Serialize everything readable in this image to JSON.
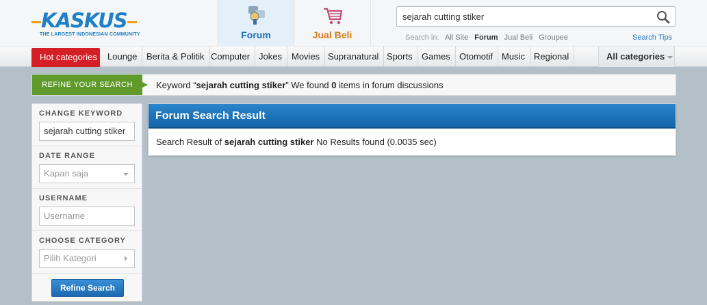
{
  "logo": {
    "text": "KASKUS",
    "tagline": "THE LARGEST INDONESIAN COMMUNITY"
  },
  "tabs": [
    {
      "label": "Forum",
      "icon": "forum-icon",
      "active": true
    },
    {
      "label": "Jual Beli",
      "icon": "shopping-cart-icon",
      "active": false
    }
  ],
  "search": {
    "value": "sejarah cutting stiker",
    "search_in_label": "Search in:",
    "options": [
      "All Site",
      "Forum",
      "Jual Beli",
      "Groupee"
    ],
    "active_option": "Forum",
    "tips": "Search Tips"
  },
  "nav": {
    "hot": "Hot categories",
    "items": [
      "Lounge",
      "Berita & Politik",
      "Computer",
      "Jokes",
      "Movies",
      "Supranatural",
      "Sports",
      "Games",
      "Otomotif",
      "Music",
      "Regional"
    ],
    "all_categories": "All categories"
  },
  "refine": {
    "tag": "REFINE YOUR SEARCH",
    "msg_prefix": "Keyword “",
    "keyword": "sejarah cutting stiker",
    "msg_mid": "” We found ",
    "count": "0",
    "msg_suffix": " items in forum discussions"
  },
  "sidebar": {
    "change_keyword_label": "CHANGE KEYWORD",
    "keyword_value": "sejarah cutting stiker",
    "date_range_label": "DATE RANGE",
    "date_range_value": "Kapan saja",
    "username_label": "USERNAME",
    "username_placeholder": "Username",
    "category_label": "CHOOSE CATEGORY",
    "category_value": "Pilih Kategori",
    "button": "Refine Search"
  },
  "result": {
    "title": "Forum Search Result",
    "prefix": "Search Result of ",
    "keyword": "sejarah cutting stiker",
    "suffix": " No Results found (0.0035 sec)"
  },
  "colors": {
    "brand_blue": "#1f7fc7",
    "hot_red": "#d51f26",
    "refine_green": "#5f9a2b",
    "jual_orange": "#d77a1a"
  }
}
